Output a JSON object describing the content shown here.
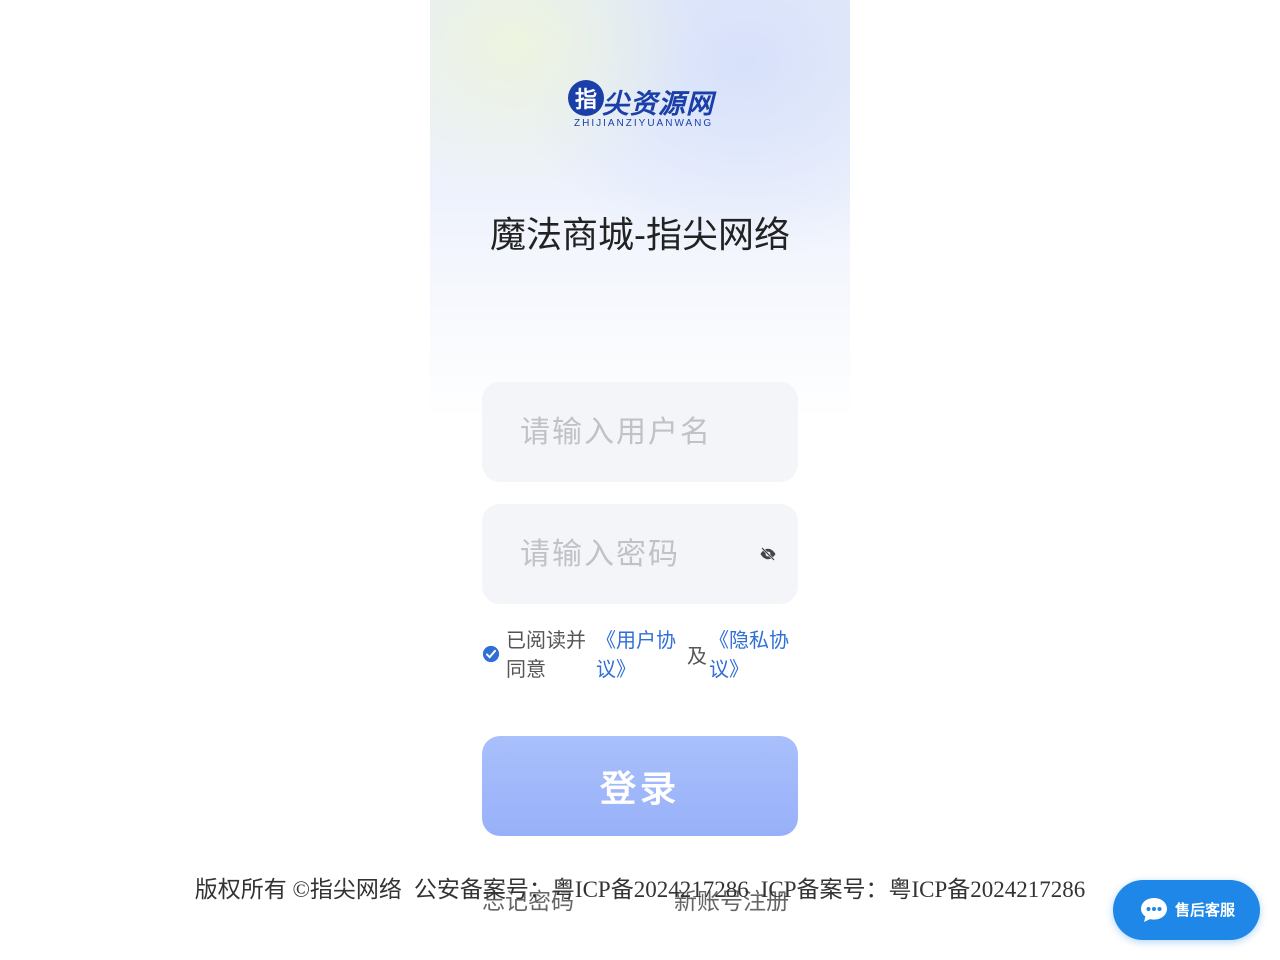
{
  "logo": {
    "mark": "指",
    "text": "尖资源网",
    "subtitle": "ZHIJIANZIYUANWANG",
    "color": "#1a3fa8"
  },
  "site_title": "魔法商城-指尖网络",
  "form": {
    "username_placeholder": "请输入用户名",
    "username_value": "",
    "password_placeholder": "请输入密码",
    "password_value": "",
    "password_toggle_icon": "eye-off-icon"
  },
  "agreement": {
    "checked": true,
    "text": "已阅读并同意",
    "user_agreement": "《用户协议》",
    "and": "及",
    "privacy_policy": "《隐私协议》",
    "link_color": "#2f6fd6"
  },
  "login_button": "登录",
  "links": {
    "forgot_password": "忘记密码",
    "register": "新账号注册"
  },
  "footer": {
    "copyright": "版权所有 ©指尖网络",
    "police_record": "公安备案号：粤ICP备2024217286",
    "icp_record": "ICP备案号：粤ICP备2024217286"
  },
  "service_widget": {
    "label": "售后客服",
    "icon": "chat-bubble-icon",
    "color": "#1e87e8"
  }
}
